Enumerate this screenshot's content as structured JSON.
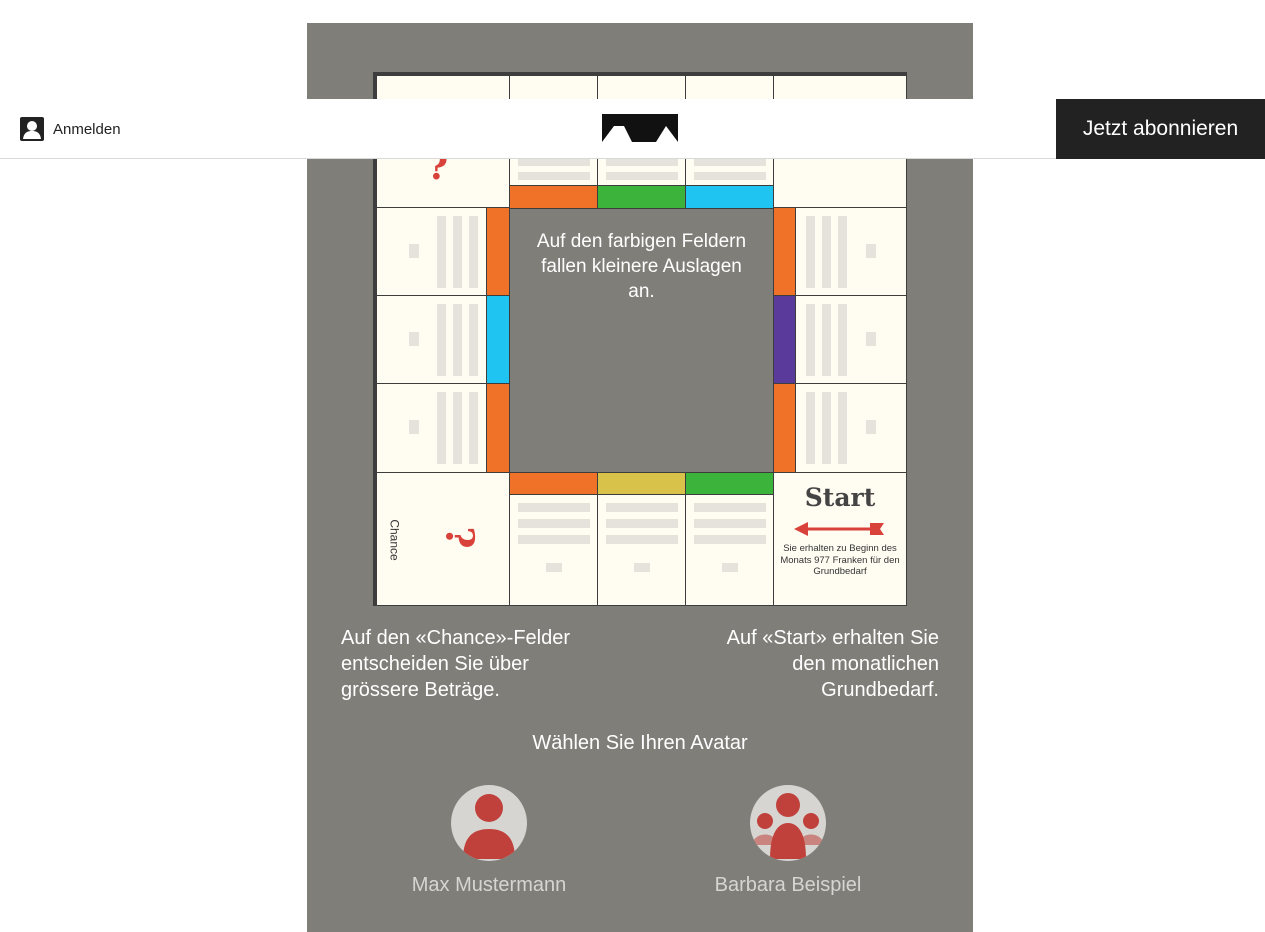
{
  "header": {
    "login_label": "Anmelden",
    "subscribe_label": "Jetzt abonnieren"
  },
  "board": {
    "center_text": "Auf den farbigen Feldern fallen kleinere Auslagen an.",
    "chance_label": "Chance",
    "question_mark": "?",
    "start_title": "Start",
    "start_description": "Sie erhalten zu Beginn des Monats 977 Franken für den Grundbedarf",
    "colors": {
      "orange": "#f07228",
      "green": "#3cb43c",
      "blue": "#1fc4f0",
      "purple": "#5a3a9a",
      "yellow": "#d9c24a",
      "red": "#d9423b"
    }
  },
  "info": {
    "chance_text": "Auf den «Chance»-Felder entscheiden Sie über grössere Beträge.",
    "start_text": "Auf «Start» erhalten Sie den monatlichen Grundbedarf."
  },
  "avatar": {
    "title": "Wählen Sie Ihren Avatar",
    "options": [
      {
        "name": "Max Mustermann",
        "icon": "single-person-icon"
      },
      {
        "name": "Barbara Beispiel",
        "icon": "family-icon"
      }
    ]
  }
}
